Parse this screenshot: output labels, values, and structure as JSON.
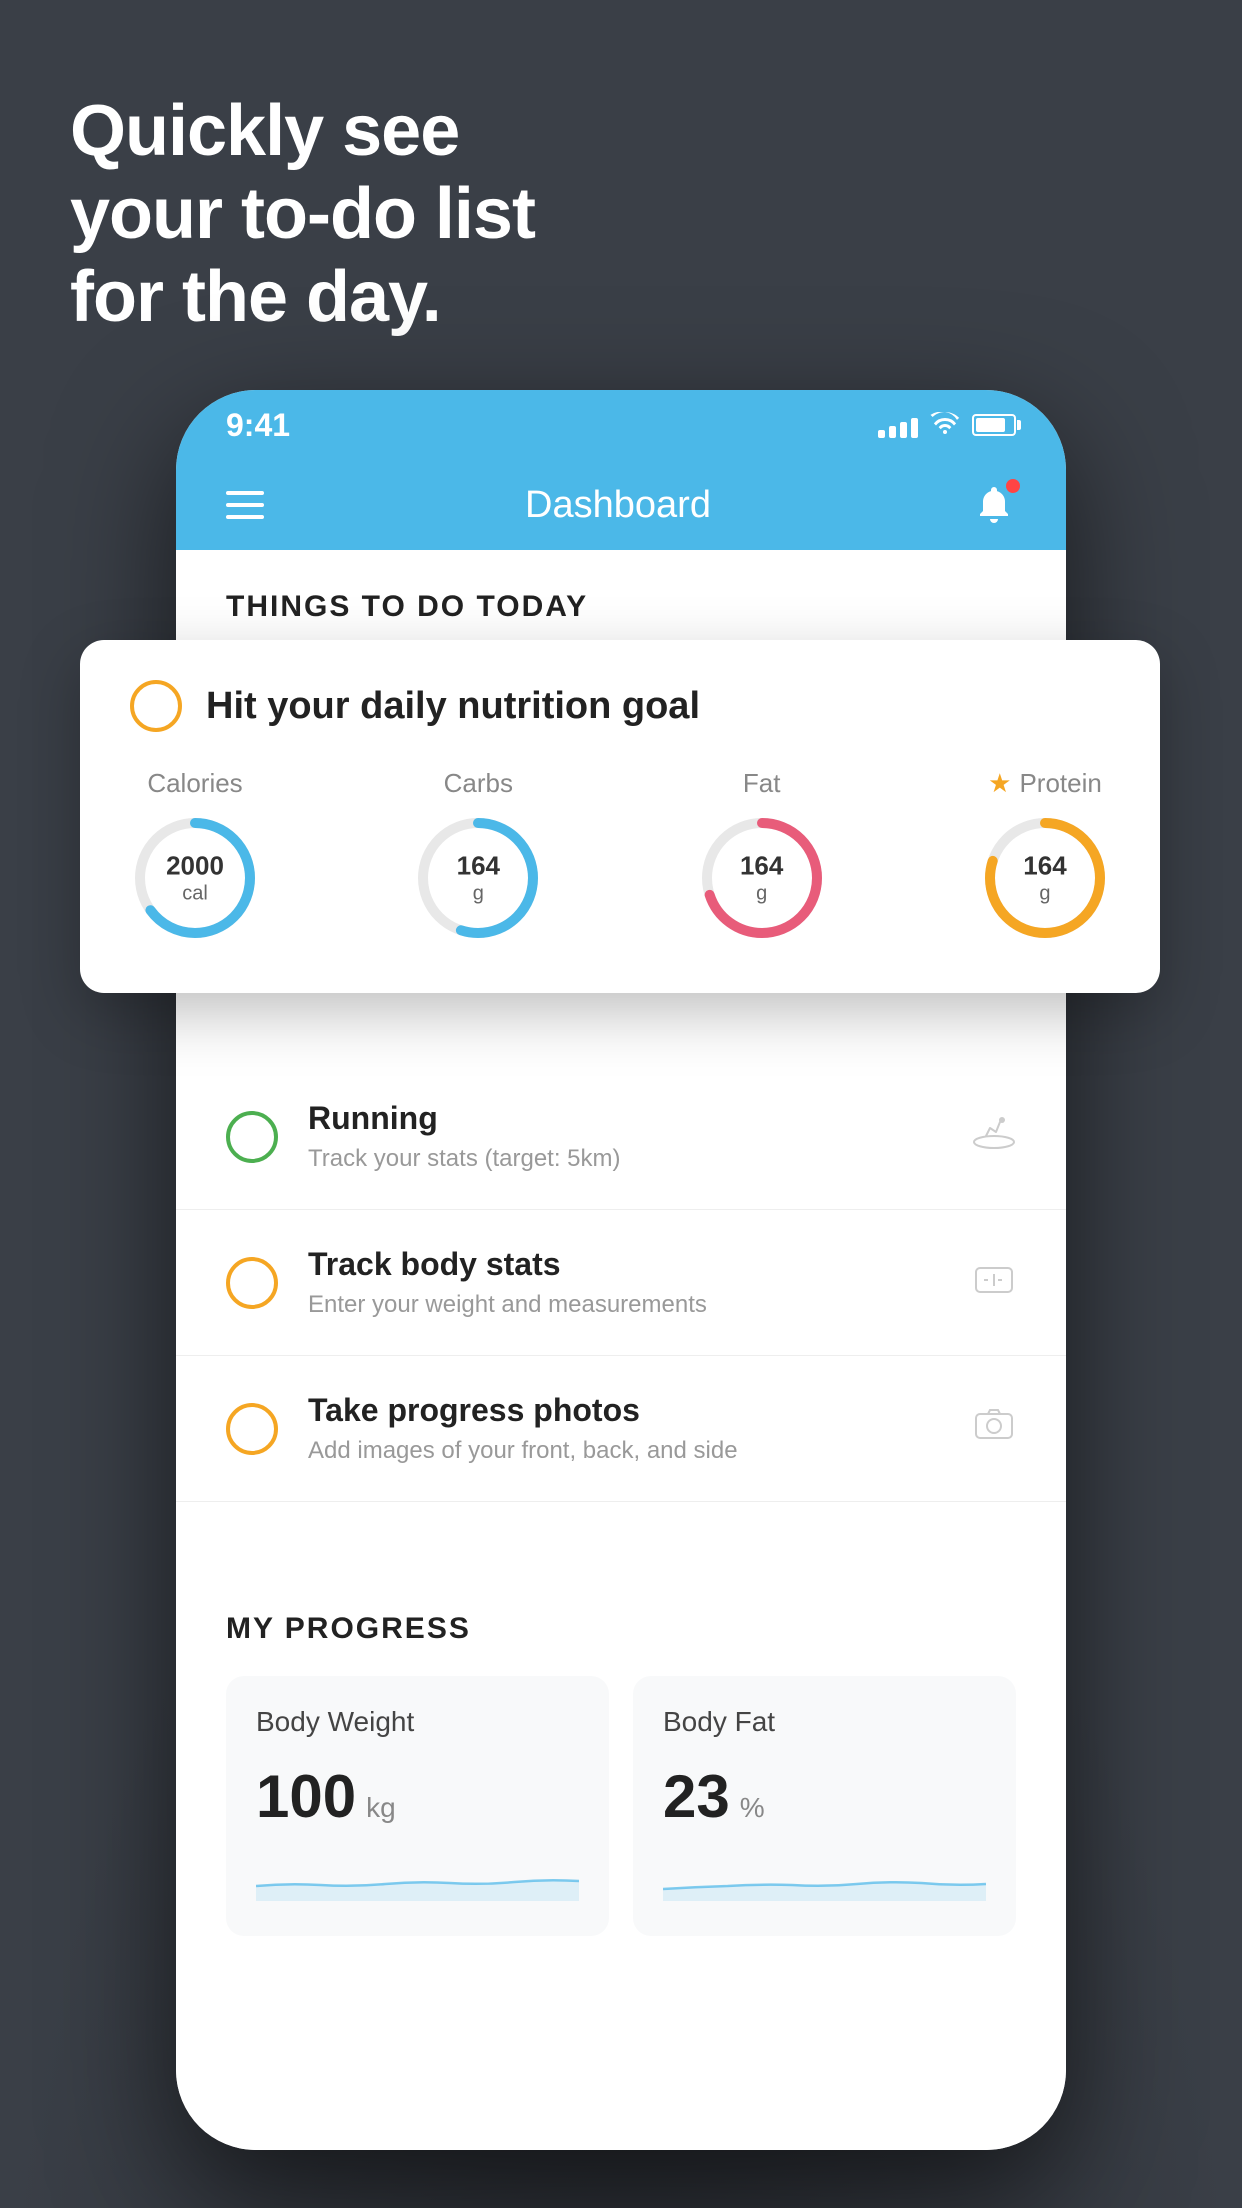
{
  "background": {
    "color": "#3a3f47"
  },
  "hero": {
    "line1": "Quickly see",
    "line2": "your to-do list",
    "line3": "for the day."
  },
  "statusBar": {
    "time": "9:41"
  },
  "navBar": {
    "title": "Dashboard"
  },
  "thingsToDoHeader": "THINGS TO DO TODAY",
  "floatingCard": {
    "title": "Hit your daily nutrition goal",
    "nutrition": [
      {
        "label": "Calories",
        "value": "2000",
        "unit": "cal",
        "type": "calories",
        "progress": 0.65
      },
      {
        "label": "Carbs",
        "value": "164",
        "unit": "g",
        "type": "carbs",
        "progress": 0.55
      },
      {
        "label": "Fat",
        "value": "164",
        "unit": "g",
        "type": "fat",
        "progress": 0.7
      },
      {
        "label": "Protein",
        "value": "164",
        "unit": "g",
        "type": "protein",
        "progress": 0.8,
        "starred": true
      }
    ]
  },
  "todoItems": [
    {
      "title": "Running",
      "subtitle": "Track your stats (target: 5km)",
      "checkType": "green",
      "iconName": "running-icon"
    },
    {
      "title": "Track body stats",
      "subtitle": "Enter your weight and measurements",
      "checkType": "yellow",
      "iconName": "scale-icon"
    },
    {
      "title": "Take progress photos",
      "subtitle": "Add images of your front, back, and side",
      "checkType": "yellow",
      "iconName": "photo-icon"
    }
  ],
  "progressSection": {
    "header": "MY PROGRESS",
    "cards": [
      {
        "title": "Body Weight",
        "value": "100",
        "unit": "kg"
      },
      {
        "title": "Body Fat",
        "value": "23",
        "unit": "%"
      }
    ]
  }
}
